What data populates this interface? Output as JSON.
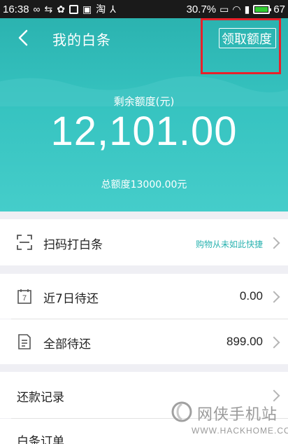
{
  "status_bar": {
    "time": "16:38",
    "icons_left": [
      "infinity-icon",
      "usb-icon",
      "paw-icon",
      "app-icon",
      "image-icon",
      "taobao-icon",
      "route-icon"
    ],
    "battery_pct": "30.7%",
    "battery_num": "67",
    "signal": "3G"
  },
  "nav": {
    "title": "我的白条",
    "action": "领取额度"
  },
  "hero": {
    "remaining_label": "剩余额度(元)",
    "remaining_amount": "12,101.00",
    "total_label": "总额度13000.00元"
  },
  "rows": {
    "scan": {
      "label": "扫码打白条",
      "hint": "购物从未如此快捷"
    },
    "due7": {
      "label": "近7日待还",
      "value": "0.00",
      "icon_text": "7"
    },
    "due_all": {
      "label": "全部待还",
      "value": "899.00"
    },
    "repay_record": {
      "label": "还款记录"
    },
    "orders": {
      "label": "白条订单"
    }
  },
  "watermark": {
    "brand": "网侠手机站",
    "url": "WWW.HACKHOME.COM"
  },
  "colors": {
    "accent": "#2bb3b0",
    "highlight": "#e8212a"
  }
}
